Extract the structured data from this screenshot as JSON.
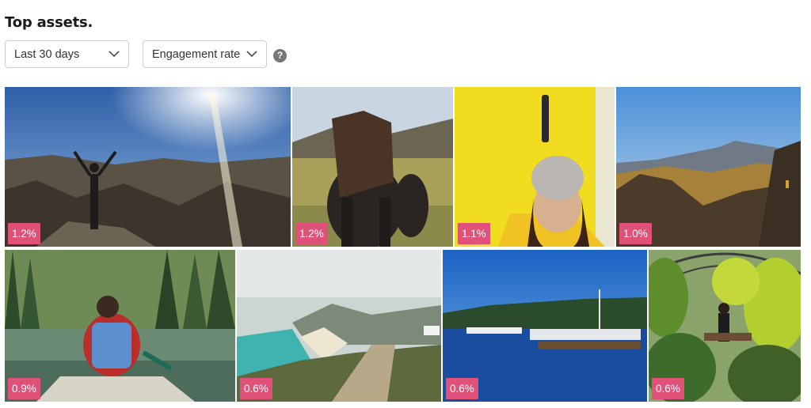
{
  "header": {
    "title": "Top assets."
  },
  "filters": {
    "range": {
      "selected": "Last 30 days"
    },
    "metric": {
      "selected": "Engagement rate"
    },
    "help_icon": "question-circle-icon",
    "help_glyph": "?"
  },
  "assets": [
    {
      "scene": "person on cliff with sun flare",
      "rate": "1.2%"
    },
    {
      "scene": "shaggy icelandic horse",
      "rate": "1.2%"
    },
    {
      "scene": "woman in beanie at yellow door",
      "rate": "1.1%"
    },
    {
      "scene": "volcanic mountain landscape",
      "rate": "1.0%"
    },
    {
      "scene": "woman in canoe on lake",
      "rate": "0.9%"
    },
    {
      "scene": "coastal cliffs and beach",
      "rate": "0.6%"
    },
    {
      "scene": "harbor with boats",
      "rate": "0.6%"
    },
    {
      "scene": "person in garden gazebo",
      "rate": "0.6%"
    }
  ],
  "colors": {
    "badge": "#e0517a",
    "title": "#1a1a1a",
    "border": "#cfcfcf"
  }
}
